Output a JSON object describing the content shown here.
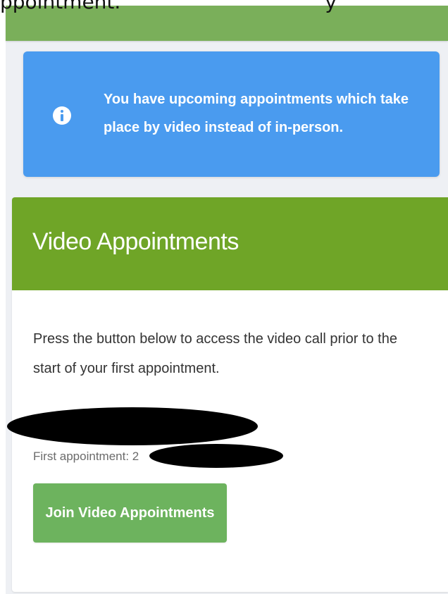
{
  "top_banner": {
    "cut_off_text": "ppointment.",
    "cut_off_trailing": "y"
  },
  "info_alert": {
    "icon": "info-circle-icon",
    "message": "You have upcoming appointments which take place by video instead of in-person."
  },
  "card": {
    "title": "Video Appointments",
    "body": "Press the button below to access the video call prior to the start of your first appointment.",
    "first_appointment_label": "First appointment: 2",
    "join_button_label": "Join Video Appointments"
  },
  "colors": {
    "top_banner": "#7aaf5a",
    "info_alert": "#4a9bef",
    "card_header": "#6fa527",
    "join_button": "#6db35e"
  }
}
